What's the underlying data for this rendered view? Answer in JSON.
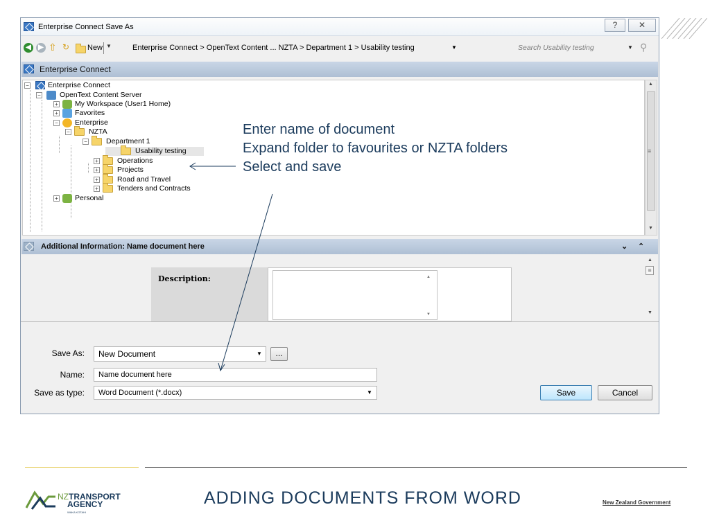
{
  "window": {
    "title": "Enterprise Connect Save As",
    "help": "?",
    "close": "✕"
  },
  "navbar": {
    "new_label": "New",
    "path": "Enterprise Connect > OpenText Content ... NZTA > Department 1 > Usability testing",
    "search_placeholder": "Search Usability testing"
  },
  "tree_header": "Enterprise Connect",
  "tree": [
    {
      "label": "Enterprise Connect"
    },
    {
      "label": "OpenText Content Server"
    },
    {
      "label": "My Workspace (User1 Home)"
    },
    {
      "label": "Favorites"
    },
    {
      "label": "Enterprise"
    },
    {
      "label": "NZTA"
    },
    {
      "label": "Department 1"
    },
    {
      "label": "Usability testing"
    },
    {
      "label": "Operations"
    },
    {
      "label": "Projects"
    },
    {
      "label": "Road and Travel"
    },
    {
      "label": "Tenders and Contracts"
    },
    {
      "label": "Personal"
    }
  ],
  "additional": {
    "header": "Additional Information: Name document here",
    "description_label": "Description:"
  },
  "form": {
    "save_as_label": "Save As:",
    "save_as_value": "New Document",
    "browse": "...",
    "name_label": "Name:",
    "name_value": "Name document here",
    "type_label": "Save as type:",
    "type_value": "Word Document (*.docx)",
    "save": "Save",
    "cancel": "Cancel"
  },
  "annotation": {
    "line1": "Enter name of document",
    "line2": "Expand folder to favourites or NZTA folders",
    "line3": "Select and save"
  },
  "footer": {
    "title": "ADDING DOCUMENTS FROM WORD",
    "logo_nz": "NZ",
    "logo_transport": "TRANSPORT",
    "logo_agency": "AGENCY",
    "logo_waka": "WAKA KOTAHI",
    "govt": "New Zealand Government"
  },
  "colors": {
    "accent": "#1b3b5c",
    "header_bar": "#aebfd4",
    "folder": "#f6d469"
  }
}
